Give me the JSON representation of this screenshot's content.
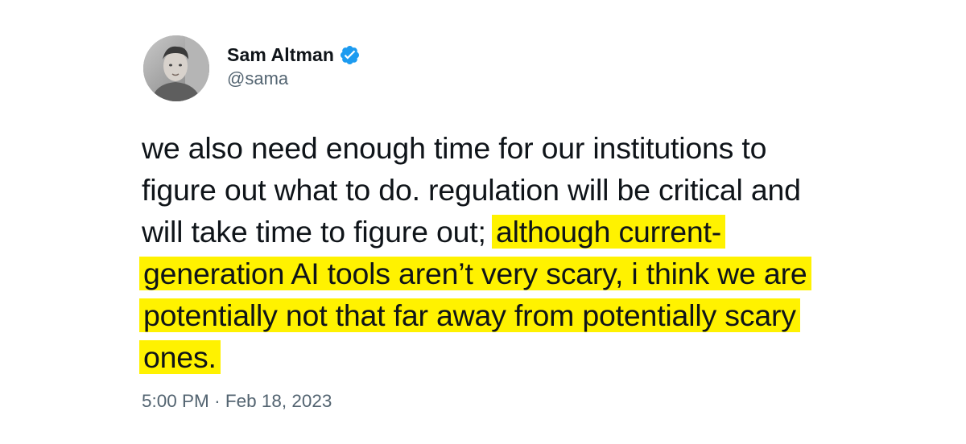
{
  "author": {
    "display_name": "Sam Altman",
    "handle": "@sama",
    "verified": true,
    "verified_color": "#1d9bf0"
  },
  "tweet": {
    "text_plain": "we also need enough time for our institutions to figure out what to do. regulation will be critical and will take time to figure out; ",
    "text_highlighted": "although current-generation AI tools aren’t very scary, i think we are potentially not that far away from potentially scary ones.",
    "highlight_color": "#fff200"
  },
  "meta": {
    "time": "5:00 PM",
    "separator": "·",
    "date": "Feb 18, 2023"
  }
}
